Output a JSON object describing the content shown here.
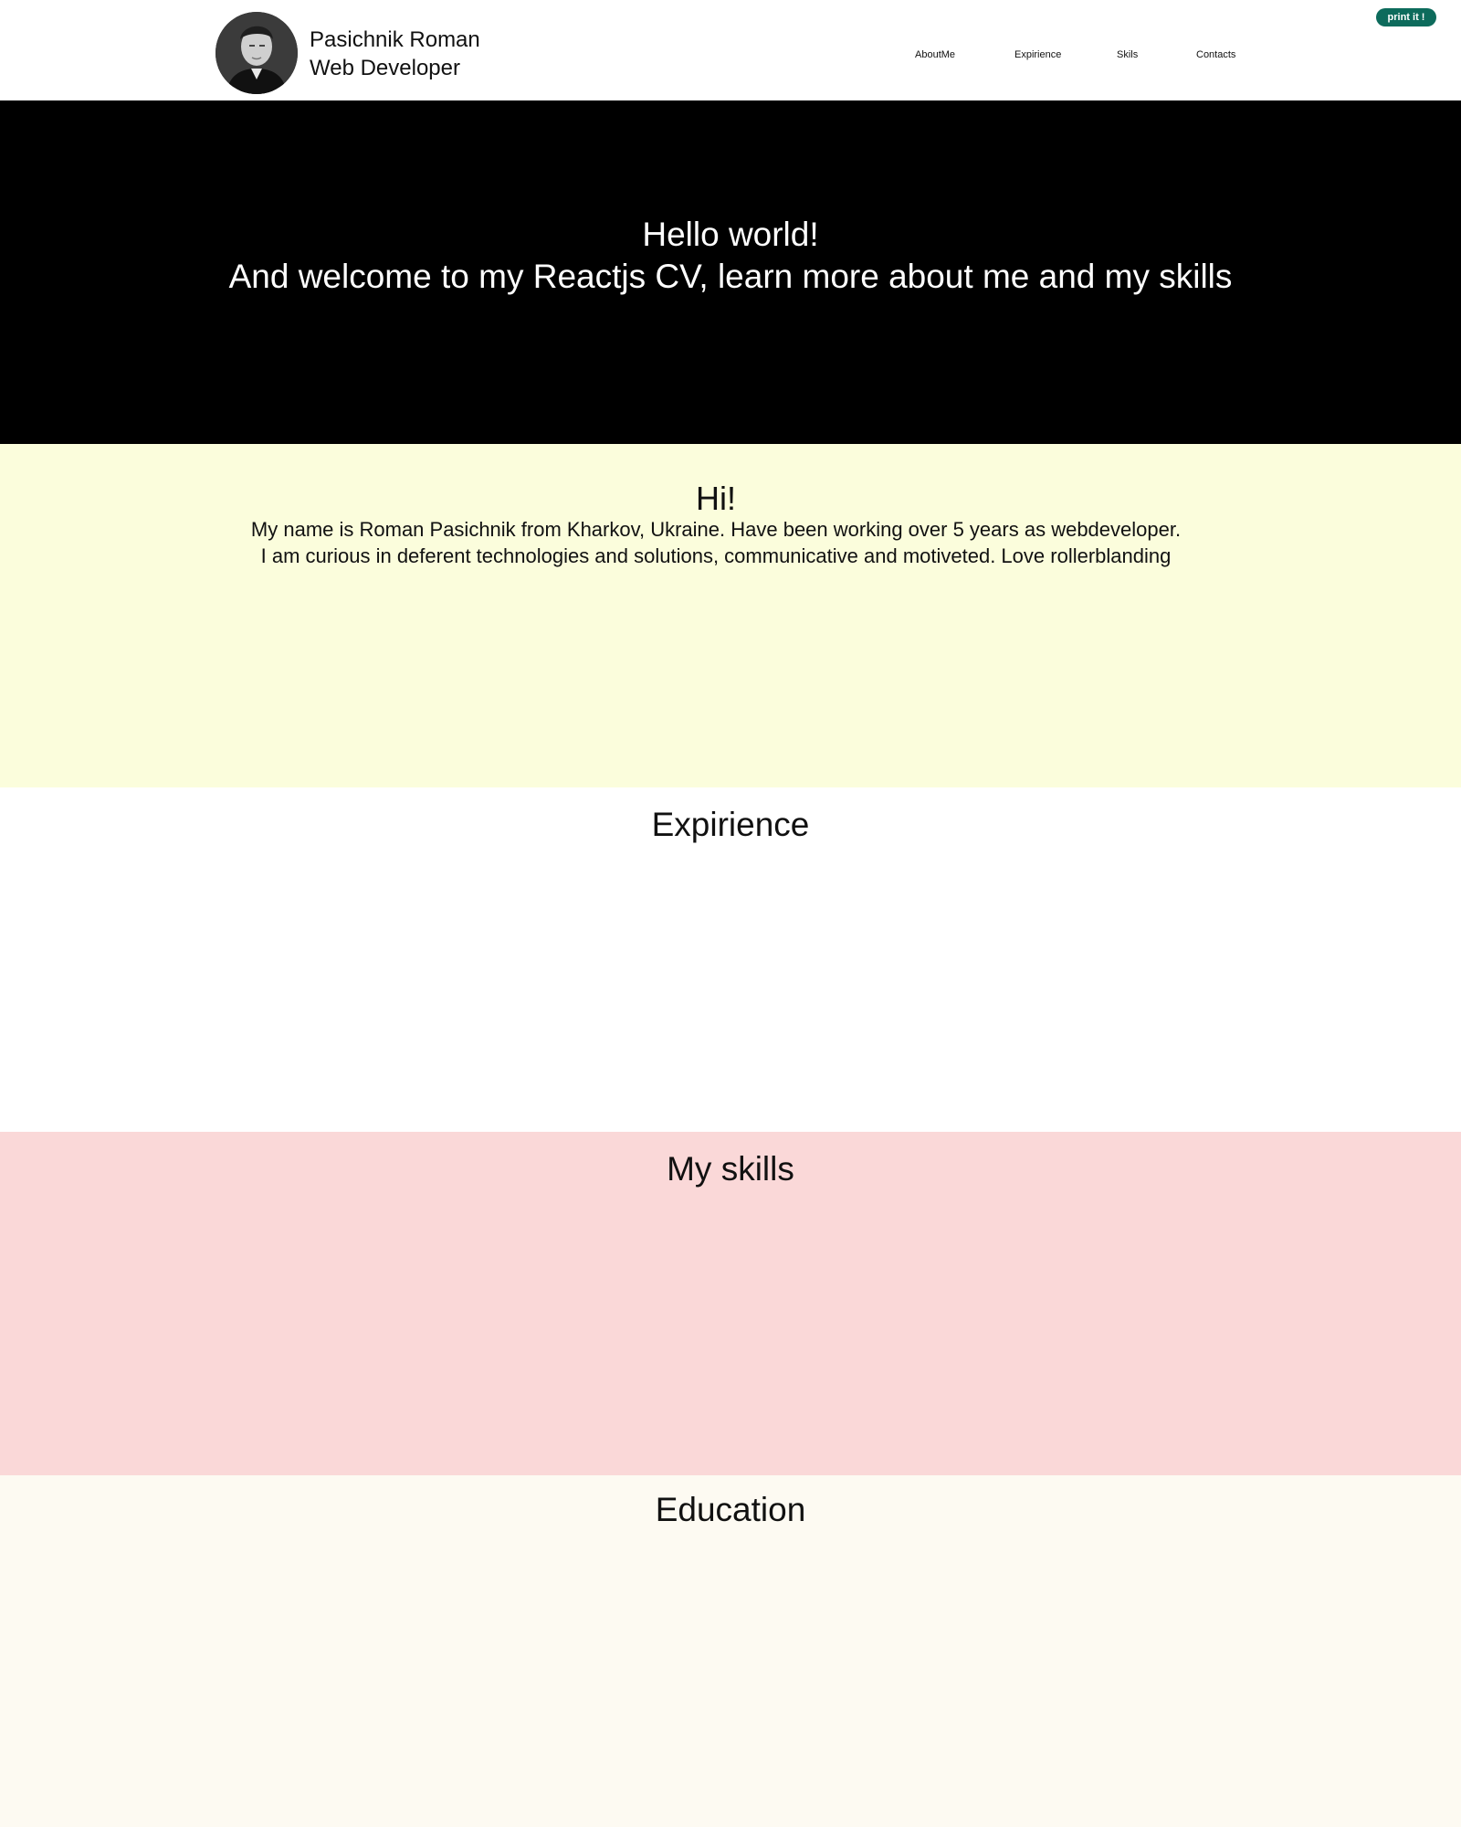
{
  "header": {
    "name": "Pasichnik Roman",
    "role": "Web Developer",
    "avatar_icon": "person-portrait-icon",
    "nav": [
      {
        "label": "AboutMe"
      },
      {
        "label": "Expirience"
      },
      {
        "label": "Skils"
      },
      {
        "label": "Contacts"
      }
    ],
    "print_label": "print it !",
    "print_color": "#0d6b5c"
  },
  "hero": {
    "line1": "Hello world!",
    "line2": "And welcome to my Reactjs CV,  learn more about me and my skills",
    "background": "#000000"
  },
  "about": {
    "title": "Hi!",
    "line1": "My name is Roman Pasichnik from Kharkov, Ukraine. Have been working over 5 years as webdeveloper.",
    "line2": "I am curious in deferent technologies and solutions, communicative and motiveted. Love rollerblanding",
    "background": "#fbfddc"
  },
  "experience": {
    "title": "Expirience",
    "background": "#ffffff"
  },
  "skills": {
    "title": "My skills",
    "background": "#fad8d8"
  },
  "education": {
    "title": "Education",
    "background": "#fdfaf2"
  }
}
